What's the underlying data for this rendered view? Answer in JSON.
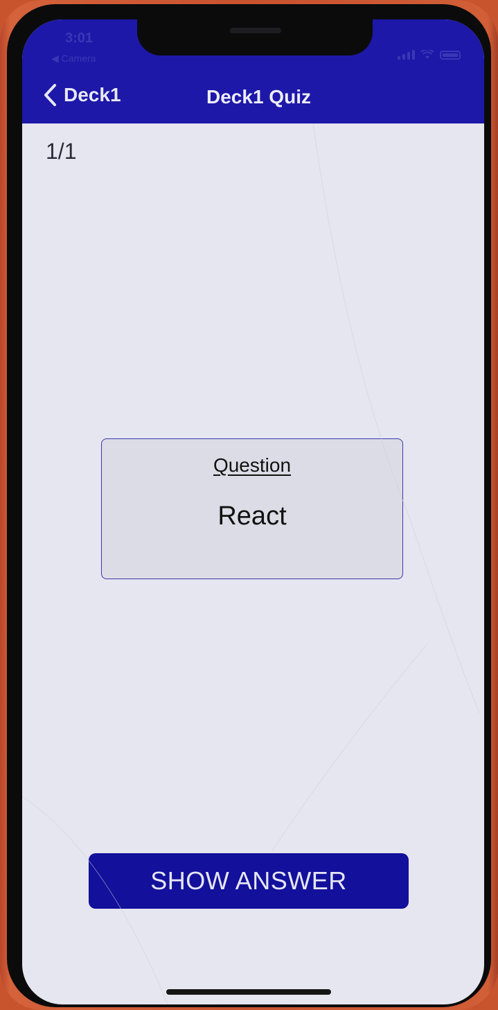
{
  "status_bar": {
    "time": "3:01",
    "back_app": "◀ Camera"
  },
  "header": {
    "back_label": "Deck1",
    "title": "Deck1 Quiz"
  },
  "quiz": {
    "progress": "1/1",
    "card_heading": "Question",
    "card_text": "React",
    "show_answer_label": "SHOW ANSWER"
  },
  "colors": {
    "header_bg": "#1d18a8",
    "button_bg": "#13109b",
    "card_border": "#3b37a8",
    "screen_bg": "#e6e6f0"
  },
  "icons": {
    "back": "chevron-left-icon",
    "signal": "signal-icon",
    "wifi": "wifi-icon",
    "battery": "battery-icon"
  }
}
